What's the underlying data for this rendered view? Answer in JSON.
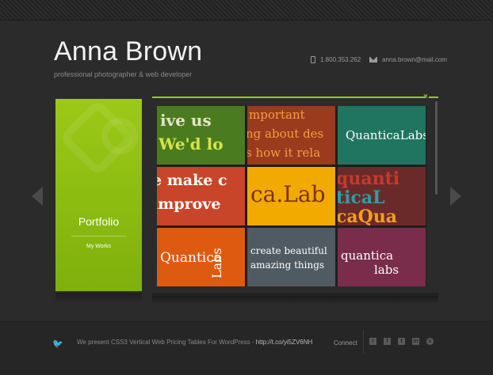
{
  "header": {
    "name": "Anna Brown",
    "tagline": "professional photographer & web developer",
    "phone": "1.800.353.262",
    "email": "anna.brown@mail.com"
  },
  "portfolio": {
    "title": "Portfolio",
    "subtitle": "My Works"
  },
  "gallery": {
    "close_icon": "×",
    "tiles": [
      {
        "bg": "#4a7c1f",
        "lines": [
          "ive us",
          "We'd lo"
        ],
        "colors": [
          "#e8e3c8",
          "#d8e24a"
        ]
      },
      {
        "bg": "#9a3b1e",
        "lines": [
          "mportant",
          "ng about des",
          "s how it rela"
        ],
        "colors": [
          "#f0a040",
          "#f0a040",
          "#f0a040"
        ]
      },
      {
        "bg": "#1f7560",
        "lines": [
          "QuanticaLabs"
        ],
        "colors": [
          "#ffffff"
        ]
      },
      {
        "bg": "#c9452a",
        "lines": [
          "e make c",
          "improve"
        ],
        "colors": [
          "#ffffff",
          "#ffffff"
        ]
      },
      {
        "bg": "#f2a900",
        "lines": [
          "ca.Lab"
        ],
        "colors": [
          "#7a3210"
        ]
      },
      {
        "bg": "#6b2a2a",
        "lines": [
          "quanti",
          "ticaL",
          "caQua"
        ],
        "colors": [
          "#c43b2e",
          "#2aa0a8",
          "#f0a020"
        ]
      },
      {
        "bg": "#de5a10",
        "lines": [
          "Quantica",
          "Labs"
        ],
        "colors": [
          "#ffffff",
          "#ffffff"
        ]
      },
      {
        "bg": "#505a62",
        "lines": [
          "create beautiful",
          "amazing things"
        ],
        "colors": [
          "#ffffff",
          "#ffffff"
        ]
      },
      {
        "bg": "#7a2d4a",
        "lines": [
          "quantica",
          "labs"
        ],
        "colors": [
          "#ffffff",
          "#ffffff"
        ]
      }
    ]
  },
  "footer": {
    "tweet_text": "We present CSS3 Vertical Web Pricing Tables For WordPress - ",
    "tweet_link": "http://t.co/yi5ZV6NH",
    "connect_label": "Connect",
    "social": [
      "rss-icon",
      "facebook-icon",
      "twitter-icon",
      "linkedin-icon",
      "skype-icon"
    ]
  }
}
